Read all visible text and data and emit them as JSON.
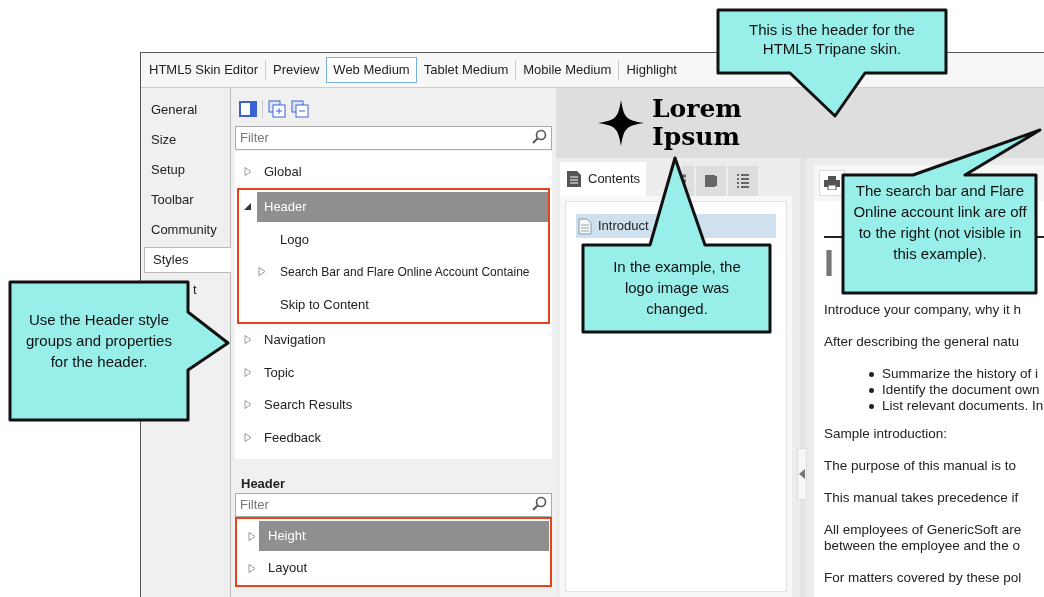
{
  "top_tabs": [
    {
      "label": "HTML5 Skin Editor",
      "selected": false
    },
    {
      "label": "Preview",
      "selected": false
    },
    {
      "label": "Web Medium",
      "selected": true
    },
    {
      "label": "Tablet Medium",
      "selected": false
    },
    {
      "label": "Mobile Medium",
      "selected": false
    },
    {
      "label": "Highlight",
      "selected": false
    }
  ],
  "side_tabs": [
    {
      "label": "General",
      "selected": false
    },
    {
      "label": "Size",
      "selected": false
    },
    {
      "label": "Setup",
      "selected": false
    },
    {
      "label": "Toolbar",
      "selected": false
    },
    {
      "label": "Community",
      "selected": false
    },
    {
      "label": "Styles",
      "selected": true
    },
    {
      "label": "t",
      "selected": false
    }
  ],
  "styles_filter": {
    "placeholder": "Filter"
  },
  "style_tree": [
    {
      "label": "Global",
      "expanded": false,
      "selected": false,
      "highlighted": false
    },
    {
      "label": "Header",
      "expanded": true,
      "selected": true,
      "highlighted": true,
      "children": [
        {
          "label": "Logo",
          "expandable": false
        },
        {
          "label": "Search Bar and Flare Online Account Containe",
          "expandable": true
        },
        {
          "label": "Skip to Content",
          "expandable": false
        }
      ]
    },
    {
      "label": "Navigation",
      "expanded": false,
      "selected": false,
      "highlighted": false
    },
    {
      "label": "Topic",
      "expanded": false,
      "selected": false,
      "highlighted": false
    },
    {
      "label": "Search Results",
      "expanded": false,
      "selected": false,
      "highlighted": false
    },
    {
      "label": "Feedback",
      "expanded": false,
      "selected": false,
      "highlighted": false
    }
  ],
  "properties": {
    "title": "Header",
    "filter_placeholder": "Filter",
    "items": [
      {
        "label": "Height",
        "selected": true
      },
      {
        "label": "Layout",
        "selected": false
      }
    ]
  },
  "preview": {
    "logo_text": [
      "Lorem",
      "Ipsum"
    ],
    "contents_tab": "Contents",
    "toc_items": [
      {
        "label": "Introduct",
        "selected": true
      }
    ],
    "topic_heading": "I",
    "paragraphs": [
      {
        "kind": "p",
        "lines": [
          "Introduce your company, why it h"
        ]
      },
      {
        "kind": "p",
        "lines": [
          "After describing the general natu"
        ]
      },
      {
        "kind": "list",
        "lines": [
          "Summarize the history of i",
          "Identify the document own",
          "List relevant documents. In"
        ]
      },
      {
        "kind": "p",
        "lines": [
          "Sample introduction:"
        ]
      },
      {
        "kind": "p",
        "lines": [
          "The purpose of this manual is to"
        ]
      },
      {
        "kind": "p",
        "lines": [
          "This manual takes precedence if"
        ]
      },
      {
        "kind": "p",
        "lines": [
          "All employees of GenericSoft are",
          "between the employee and the o"
        ]
      },
      {
        "kind": "p",
        "lines": [
          "For matters covered by these pol"
        ]
      }
    ]
  },
  "callouts": [
    {
      "text": "This is the header for the HTML5 Tripane skin."
    },
    {
      "text": "Use the Header style groups and properties for the header."
    },
    {
      "text": "In the example, the logo image was changed."
    },
    {
      "text": "The search bar and Flare Online account link are off to the right (not visible in this example)."
    }
  ]
}
